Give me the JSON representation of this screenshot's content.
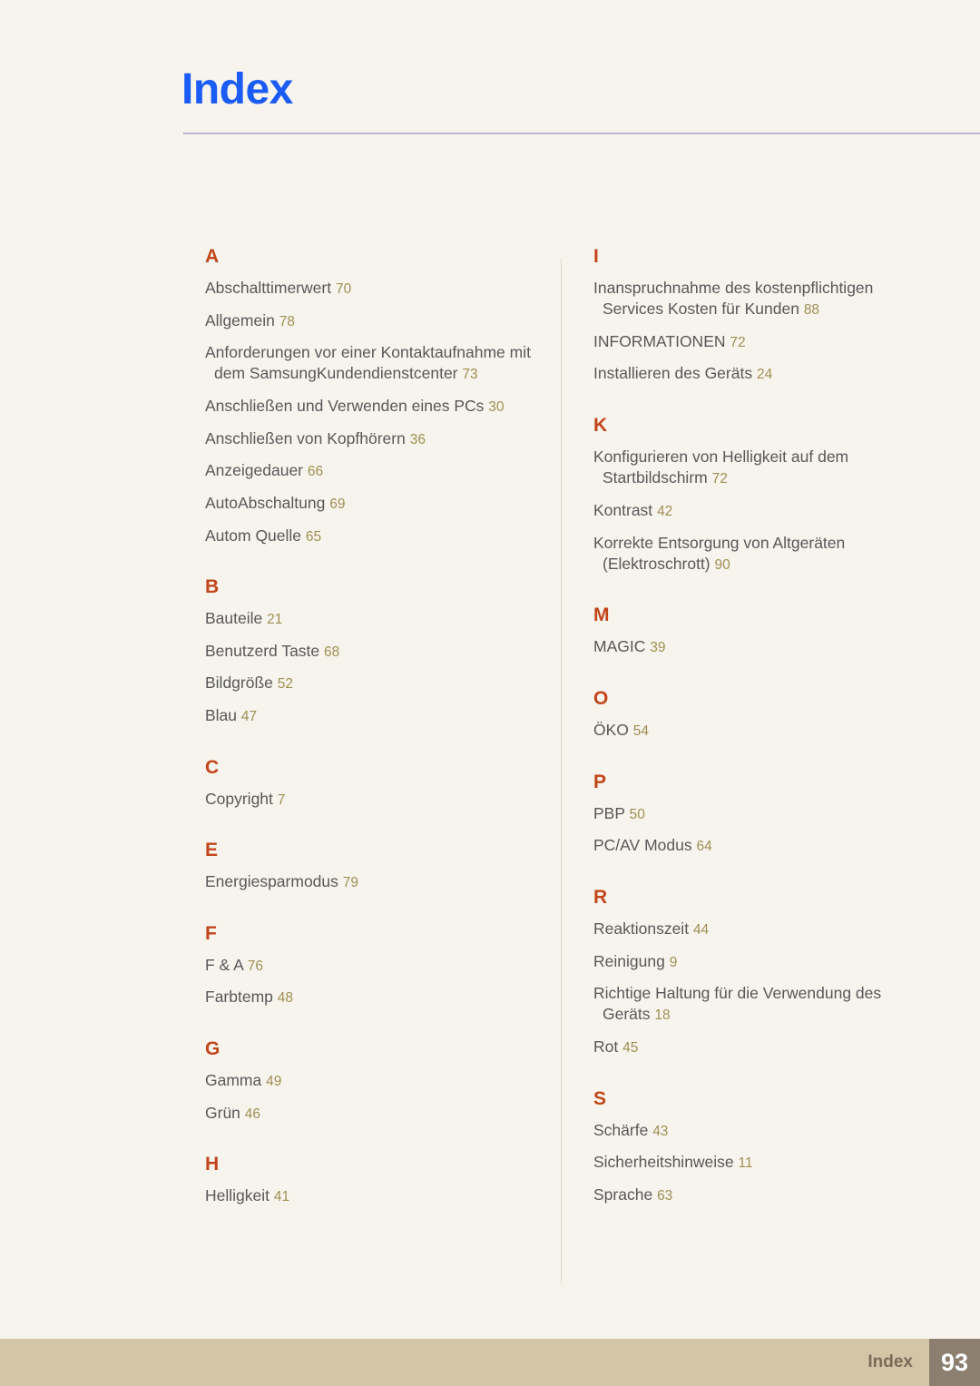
{
  "header": {
    "title": "Index"
  },
  "columns": {
    "left": [
      {
        "letter": "A",
        "entries": [
          {
            "text": "Abschalttimerwert",
            "page": "70"
          },
          {
            "text": "Allgemein",
            "page": "78"
          },
          {
            "text": "Anforderungen vor einer Kontaktaufnahme mit dem SamsungKundendienstcenter",
            "page": "73"
          },
          {
            "text": "Anschließen und Verwenden eines PCs",
            "page": "30"
          },
          {
            "text": "Anschließen von Kopfhörern",
            "page": "36"
          },
          {
            "text": "Anzeigedauer",
            "page": "66"
          },
          {
            "text": "AutoAbschaltung",
            "page": "69"
          },
          {
            "text": "Autom Quelle",
            "page": "65"
          }
        ]
      },
      {
        "letter": "B",
        "entries": [
          {
            "text": "Bauteile",
            "page": "21"
          },
          {
            "text": "Benutzerd Taste",
            "page": "68"
          },
          {
            "text": "Bildgröße",
            "page": "52"
          },
          {
            "text": "Blau",
            "page": "47"
          }
        ]
      },
      {
        "letter": "C",
        "entries": [
          {
            "text": "Copyright",
            "page": "7"
          }
        ]
      },
      {
        "letter": "E",
        "entries": [
          {
            "text": "Energiesparmodus",
            "page": "79"
          }
        ]
      },
      {
        "letter": "F",
        "entries": [
          {
            "text": "F & A",
            "page": "76"
          },
          {
            "text": "Farbtemp",
            "page": "48"
          }
        ]
      },
      {
        "letter": "G",
        "entries": [
          {
            "text": "Gamma",
            "page": "49"
          },
          {
            "text": "Grün",
            "page": "46"
          }
        ]
      },
      {
        "letter": "H",
        "entries": [
          {
            "text": "Helligkeit",
            "page": "41"
          }
        ]
      }
    ],
    "right": [
      {
        "letter": "I",
        "entries": [
          {
            "text": "Inanspruchnahme des kostenpflichtigen Services Kosten für Kunden",
            "page": "88"
          },
          {
            "text": "INFORMATIONEN",
            "page": "72"
          },
          {
            "text": "Installieren des Geräts",
            "page": "24"
          }
        ]
      },
      {
        "letter": "K",
        "entries": [
          {
            "text": "Konfigurieren von Helligkeit auf dem Startbildschirm",
            "page": "72"
          },
          {
            "text": "Kontrast",
            "page": "42"
          },
          {
            "text": "Korrekte Entsorgung von Altgeräten (Elektroschrott)",
            "page": "90"
          }
        ]
      },
      {
        "letter": "M",
        "entries": [
          {
            "text": "MAGIC",
            "page": "39"
          }
        ]
      },
      {
        "letter": "O",
        "entries": [
          {
            "text": "ÖKO",
            "page": "54"
          }
        ]
      },
      {
        "letter": "P",
        "entries": [
          {
            "text": "PBP",
            "page": "50"
          },
          {
            "text": "PC/AV Modus",
            "page": "64"
          }
        ]
      },
      {
        "letter": "R",
        "entries": [
          {
            "text": "Reaktionszeit",
            "page": "44"
          },
          {
            "text": "Reinigung",
            "page": "9"
          },
          {
            "text": "Richtige Haltung für die Verwendung des Geräts",
            "page": "18"
          },
          {
            "text": "Rot",
            "page": "45"
          }
        ]
      },
      {
        "letter": "S",
        "entries": [
          {
            "text": "Schärfe",
            "page": "43"
          },
          {
            "text": "Sicherheitshinweise",
            "page": "11"
          },
          {
            "text": "Sprache",
            "page": "63"
          }
        ]
      }
    ]
  },
  "footer": {
    "label": "Index",
    "page_number": "93"
  },
  "colors": {
    "page_background": "#f6f4ec",
    "title": "#1a5cf5",
    "section_letter": "#c2451b",
    "entry_text": "#58585a",
    "page_number_text": "#a08f55",
    "footer_bar": "#d3c5a6",
    "footer_pagenum_box": "#8c7f70",
    "title_rule": "#b3aad6",
    "column_divider": "#e2d9cd"
  }
}
